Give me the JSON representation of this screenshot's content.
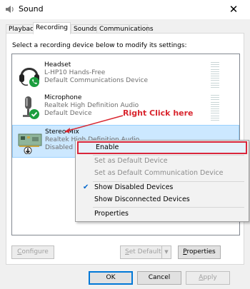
{
  "window": {
    "title": "Sound",
    "close_glyph": "✕"
  },
  "tabs": [
    {
      "label": "Playback",
      "active": false
    },
    {
      "label": "Recording",
      "active": true
    },
    {
      "label": "Sounds",
      "active": false
    },
    {
      "label": "Communications",
      "active": false
    }
  ],
  "instruction": "Select a recording device below to modify its settings:",
  "devices": [
    {
      "name": "Headset",
      "line1": "L-HP10 Hands-Free",
      "line2": "Default Communications Device",
      "icon": "headset-icon",
      "badge": "phone-badge-icon",
      "badge_color": "#1b9e3e",
      "selected": false
    },
    {
      "name": "Microphone",
      "line1": "Realtek High Definition Audio",
      "line2": "Default Device",
      "icon": "microphone-icon",
      "badge": "check-badge-icon",
      "badge_color": "#1b9e3e",
      "selected": false
    },
    {
      "name": "Stereo Mix",
      "line1": "Realtek High Definition Audio",
      "line2": "Disabled",
      "icon": "sound-card-icon",
      "badge": "down-arrow-badge-icon",
      "badge_color": "#222222",
      "selected": true
    }
  ],
  "annotation": {
    "text": "Right Click here",
    "color": "#d9262f"
  },
  "context_menu": {
    "items": [
      {
        "label": "Enable",
        "state": "highlighted"
      },
      {
        "label": "Set as Default Device",
        "state": "disabled"
      },
      {
        "label": "Set as Default Communication Device",
        "state": "disabled"
      },
      {
        "label": "Show Disabled Devices",
        "state": "checked"
      },
      {
        "label": "Show Disconnected Devices",
        "state": "normal"
      },
      {
        "label": "Properties",
        "state": "normal"
      }
    ]
  },
  "buttons": {
    "configure": {
      "first": "C",
      "rest": "onfigure"
    },
    "set_default": {
      "first": "S",
      "rest": "et Default"
    },
    "properties": {
      "first": "P",
      "rest": "roperties"
    },
    "ok": "OK",
    "cancel": "Cancel",
    "apply": {
      "first": "A",
      "rest": "pply"
    }
  },
  "colors": {
    "selection": "#cce8ff",
    "menu_highlight_border": "#d9263b",
    "accent": "#0078d7"
  }
}
